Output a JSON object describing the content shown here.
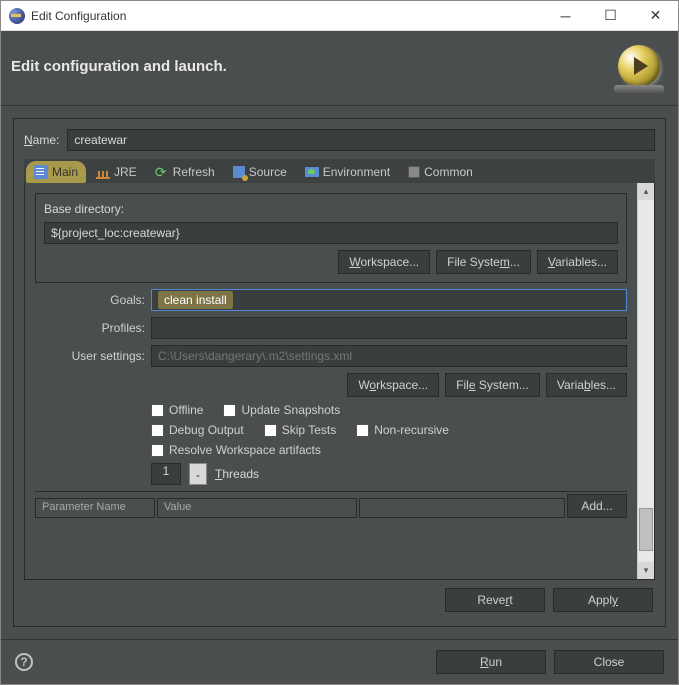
{
  "window": {
    "title": "Edit Configuration"
  },
  "header": {
    "title": "Edit configuration and launch."
  },
  "form": {
    "name_label": "Name:",
    "name_value": "createwar"
  },
  "tabs": {
    "main": "Main",
    "jre": "JRE",
    "refresh": "Refresh",
    "source": "Source",
    "environment": "Environment",
    "common": "Common"
  },
  "main": {
    "base_dir_label": "Base directory:",
    "base_dir_value": "${project_loc:createwar}",
    "workspace_btn": "Workspace...",
    "filesystem_btn": "File System...",
    "variables_btn": "Variables...",
    "goals_label": "Goals:",
    "goals_value": "clean install",
    "profiles_label": "Profiles:",
    "profiles_value": "",
    "usersettings_label": "User settings:",
    "usersettings_placeholder": "C:\\Users\\dangerary\\.m2\\settings.xml",
    "check_offline": "Offline",
    "check_update": "Update Snapshots",
    "check_debug": "Debug Output",
    "check_skip": "Skip Tests",
    "check_nonrec": "Non-recursive",
    "check_resolve": "Resolve Workspace artifacts",
    "threads_value": "1",
    "threads_label": "Threads",
    "param_name_col": "Parameter Name",
    "param_value_col": "Value",
    "add_btn": "Add..."
  },
  "buttons": {
    "revert": "Revert",
    "apply": "Apply",
    "run": "Run",
    "close": "Close"
  }
}
